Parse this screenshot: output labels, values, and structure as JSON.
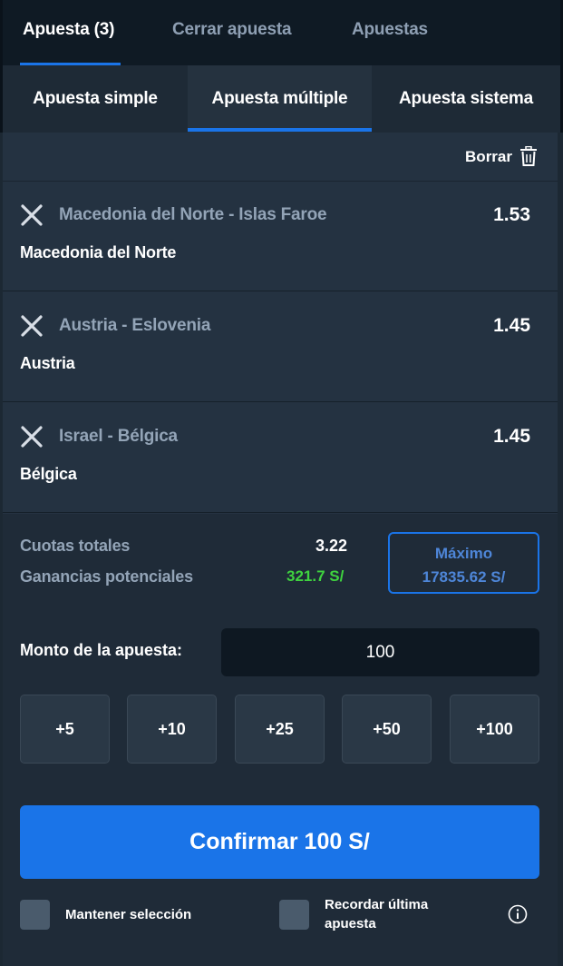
{
  "top_tabs": [
    {
      "label": "Apuesta (3)",
      "active": true
    },
    {
      "label": "Cerrar apuesta",
      "active": false
    },
    {
      "label": "Apuestas",
      "active": false
    }
  ],
  "sub_tabs": [
    {
      "label": "Apuesta simple",
      "active": false
    },
    {
      "label": "Apuesta múltiple",
      "active": true
    },
    {
      "label": "Apuesta sistema",
      "active": false
    }
  ],
  "clear": {
    "label": "Borrar",
    "icon": "trash-icon"
  },
  "selections": [
    {
      "event": "Macedonia del Norte - Islas Faroe",
      "odds": "1.53",
      "pick": "Macedonia del Norte"
    },
    {
      "event": "Austria - Eslovenia",
      "odds": "1.45",
      "pick": "Austria"
    },
    {
      "event": "Israel - Bélgica",
      "odds": "1.45",
      "pick": "Bélgica"
    }
  ],
  "summary": {
    "total_odds_label": "Cuotas totales",
    "total_odds_value": "3.22",
    "potential_label": "Ganancias potenciales",
    "potential_value": "321.7 S/",
    "max_label": "Máximo",
    "max_value": "17835.62 S/"
  },
  "stake": {
    "label": "Monto de la apuesta:",
    "value": "100"
  },
  "quick_amounts": [
    "+5",
    "+10",
    "+25",
    "+50",
    "+100"
  ],
  "confirm_label": "Confirmar 100 S/",
  "options": [
    {
      "label": "Mantener selección",
      "checked": false
    },
    {
      "label_line1": "Recordar última",
      "label_line2": "apuesta",
      "checked": false
    }
  ],
  "colors": {
    "accent": "#1a74e8",
    "positive": "#3fd33f",
    "background": "#1c2833"
  }
}
